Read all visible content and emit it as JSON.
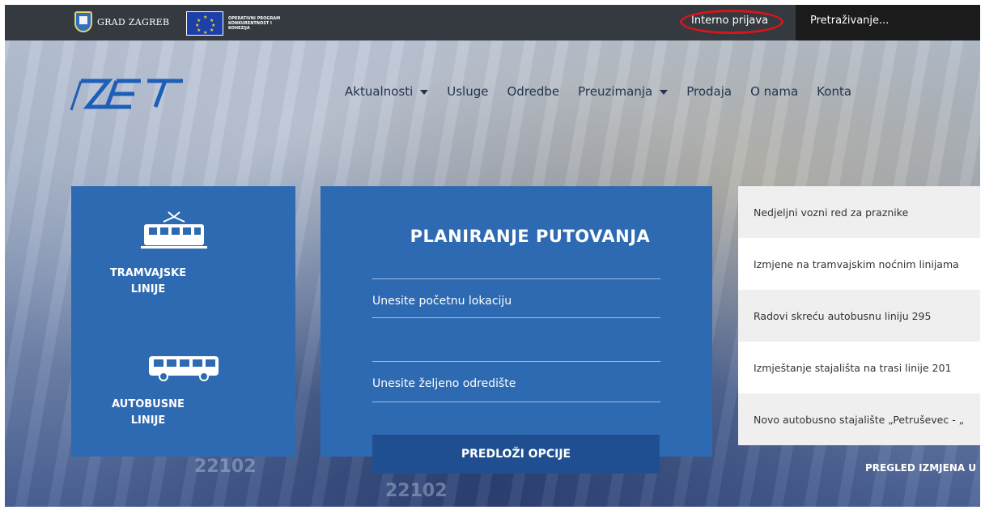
{
  "topbar": {
    "city_label": "GRAD ZAGREB",
    "eu_program_label": "OPERATIVNI PROGRAM KONKURENTNOST I KOHEZIJA",
    "login_label": "Interno prijava",
    "search_placeholder": "Pretraživanje..."
  },
  "nav": {
    "items": [
      {
        "label": "Aktualnosti",
        "has_dropdown": true
      },
      {
        "label": "Usluge",
        "has_dropdown": false
      },
      {
        "label": "Odredbe",
        "has_dropdown": false
      },
      {
        "label": "Preuzimanja",
        "has_dropdown": true
      },
      {
        "label": "Prodaja",
        "has_dropdown": false
      },
      {
        "label": "O nama",
        "has_dropdown": false
      },
      {
        "label": "Konta",
        "has_dropdown": false
      }
    ]
  },
  "lines": {
    "tram_label_line1": "TRAMVAJSKE",
    "tram_label_line2": "LINIJE",
    "bus_label_line1": "AUTOBUSNE",
    "bus_label_line2": "LINIJE"
  },
  "planner": {
    "title": "PLANIRANJE PUTOVANJA",
    "start_placeholder": "Unesite početnu lokaciju",
    "destination_placeholder": "Unesite željeno odredište",
    "submit_label": "PREDLOŽI OPCIJE"
  },
  "news": {
    "items": [
      "Nedjeljni vozni red za praznike",
      "Izmjene na tramvajskim noćnim linijama",
      "Radovi skreću autobusnu liniju 295",
      "Izmještanje stajališta na trasi linije 201",
      "Novo autobusno stajalište „Petruševec - „"
    ],
    "more_label": "PREGLED IZMJENA U"
  },
  "background": {
    "vehicle_number_1": "22102",
    "vehicle_number_2": "22102"
  },
  "colors": {
    "topbar": "#343a40",
    "panel_blue": "#2d6ab2",
    "button_blue": "#1f4f91",
    "highlight_ring": "#d9141b"
  }
}
